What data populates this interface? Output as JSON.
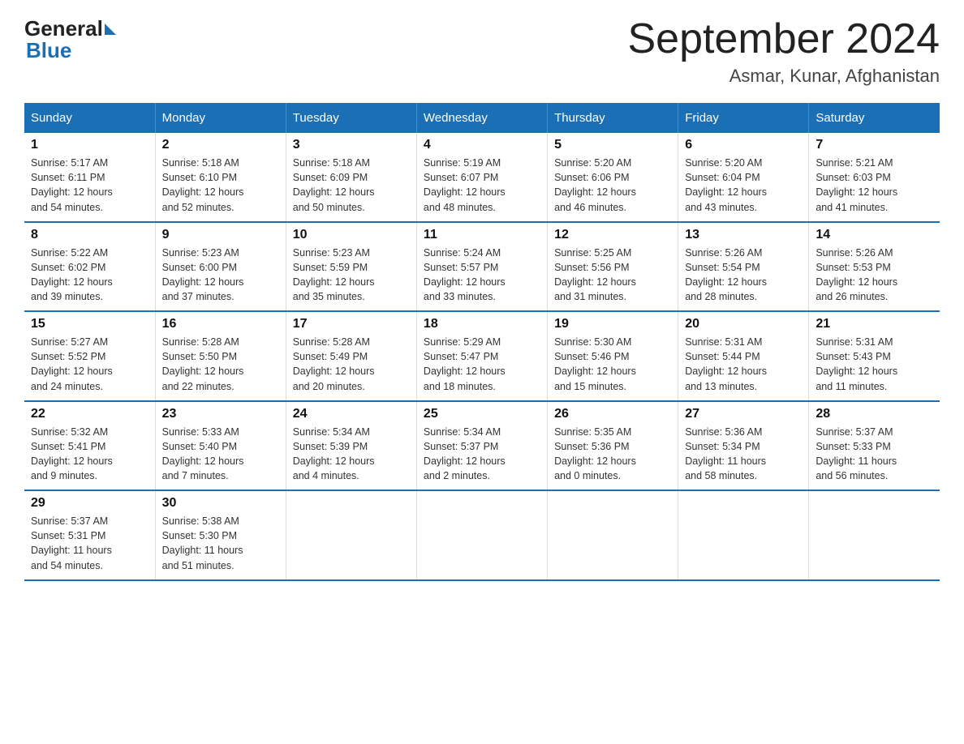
{
  "header": {
    "logo_text_general": "General",
    "logo_text_blue": "Blue",
    "month_year": "September 2024",
    "location": "Asmar, Kunar, Afghanistan"
  },
  "days_of_week": [
    "Sunday",
    "Monday",
    "Tuesday",
    "Wednesday",
    "Thursday",
    "Friday",
    "Saturday"
  ],
  "weeks": [
    [
      {
        "day": "1",
        "sunrise": "5:17 AM",
        "sunset": "6:11 PM",
        "daylight": "12 hours and 54 minutes."
      },
      {
        "day": "2",
        "sunrise": "5:18 AM",
        "sunset": "6:10 PM",
        "daylight": "12 hours and 52 minutes."
      },
      {
        "day": "3",
        "sunrise": "5:18 AM",
        "sunset": "6:09 PM",
        "daylight": "12 hours and 50 minutes."
      },
      {
        "day": "4",
        "sunrise": "5:19 AM",
        "sunset": "6:07 PM",
        "daylight": "12 hours and 48 minutes."
      },
      {
        "day": "5",
        "sunrise": "5:20 AM",
        "sunset": "6:06 PM",
        "daylight": "12 hours and 46 minutes."
      },
      {
        "day": "6",
        "sunrise": "5:20 AM",
        "sunset": "6:04 PM",
        "daylight": "12 hours and 43 minutes."
      },
      {
        "day": "7",
        "sunrise": "5:21 AM",
        "sunset": "6:03 PM",
        "daylight": "12 hours and 41 minutes."
      }
    ],
    [
      {
        "day": "8",
        "sunrise": "5:22 AM",
        "sunset": "6:02 PM",
        "daylight": "12 hours and 39 minutes."
      },
      {
        "day": "9",
        "sunrise": "5:23 AM",
        "sunset": "6:00 PM",
        "daylight": "12 hours and 37 minutes."
      },
      {
        "day": "10",
        "sunrise": "5:23 AM",
        "sunset": "5:59 PM",
        "daylight": "12 hours and 35 minutes."
      },
      {
        "day": "11",
        "sunrise": "5:24 AM",
        "sunset": "5:57 PM",
        "daylight": "12 hours and 33 minutes."
      },
      {
        "day": "12",
        "sunrise": "5:25 AM",
        "sunset": "5:56 PM",
        "daylight": "12 hours and 31 minutes."
      },
      {
        "day": "13",
        "sunrise": "5:26 AM",
        "sunset": "5:54 PM",
        "daylight": "12 hours and 28 minutes."
      },
      {
        "day": "14",
        "sunrise": "5:26 AM",
        "sunset": "5:53 PM",
        "daylight": "12 hours and 26 minutes."
      }
    ],
    [
      {
        "day": "15",
        "sunrise": "5:27 AM",
        "sunset": "5:52 PM",
        "daylight": "12 hours and 24 minutes."
      },
      {
        "day": "16",
        "sunrise": "5:28 AM",
        "sunset": "5:50 PM",
        "daylight": "12 hours and 22 minutes."
      },
      {
        "day": "17",
        "sunrise": "5:28 AM",
        "sunset": "5:49 PM",
        "daylight": "12 hours and 20 minutes."
      },
      {
        "day": "18",
        "sunrise": "5:29 AM",
        "sunset": "5:47 PM",
        "daylight": "12 hours and 18 minutes."
      },
      {
        "day": "19",
        "sunrise": "5:30 AM",
        "sunset": "5:46 PM",
        "daylight": "12 hours and 15 minutes."
      },
      {
        "day": "20",
        "sunrise": "5:31 AM",
        "sunset": "5:44 PM",
        "daylight": "12 hours and 13 minutes."
      },
      {
        "day": "21",
        "sunrise": "5:31 AM",
        "sunset": "5:43 PM",
        "daylight": "12 hours and 11 minutes."
      }
    ],
    [
      {
        "day": "22",
        "sunrise": "5:32 AM",
        "sunset": "5:41 PM",
        "daylight": "12 hours and 9 minutes."
      },
      {
        "day": "23",
        "sunrise": "5:33 AM",
        "sunset": "5:40 PM",
        "daylight": "12 hours and 7 minutes."
      },
      {
        "day": "24",
        "sunrise": "5:34 AM",
        "sunset": "5:39 PM",
        "daylight": "12 hours and 4 minutes."
      },
      {
        "day": "25",
        "sunrise": "5:34 AM",
        "sunset": "5:37 PM",
        "daylight": "12 hours and 2 minutes."
      },
      {
        "day": "26",
        "sunrise": "5:35 AM",
        "sunset": "5:36 PM",
        "daylight": "12 hours and 0 minutes."
      },
      {
        "day": "27",
        "sunrise": "5:36 AM",
        "sunset": "5:34 PM",
        "daylight": "11 hours and 58 minutes."
      },
      {
        "day": "28",
        "sunrise": "5:37 AM",
        "sunset": "5:33 PM",
        "daylight": "11 hours and 56 minutes."
      }
    ],
    [
      {
        "day": "29",
        "sunrise": "5:37 AM",
        "sunset": "5:31 PM",
        "daylight": "11 hours and 54 minutes."
      },
      {
        "day": "30",
        "sunrise": "5:38 AM",
        "sunset": "5:30 PM",
        "daylight": "11 hours and 51 minutes."
      },
      null,
      null,
      null,
      null,
      null
    ]
  ],
  "labels": {
    "sunrise": "Sunrise:",
    "sunset": "Sunset:",
    "daylight": "Daylight:"
  }
}
